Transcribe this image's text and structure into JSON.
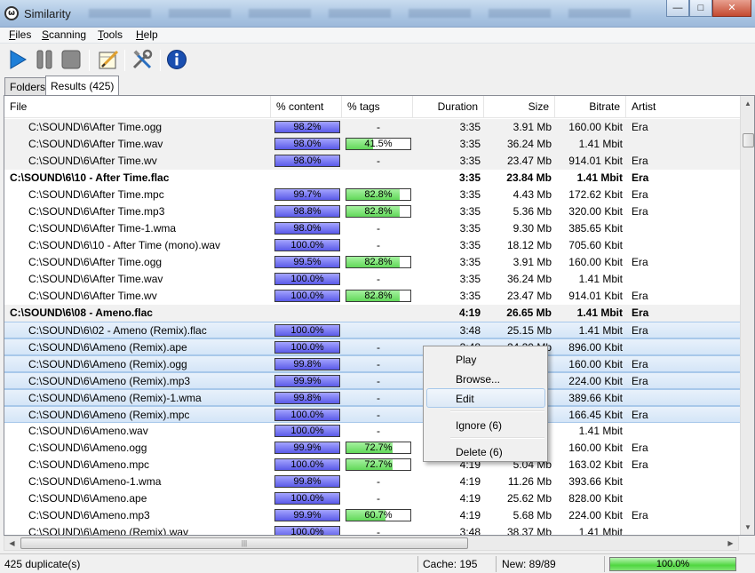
{
  "window": {
    "title": "Similarity"
  },
  "menu": {
    "files": "Files",
    "scanning": "Scanning",
    "tools": "Tools",
    "help": "Help"
  },
  "toolbar": {
    "icons": [
      "play-icon",
      "pause-icon",
      "stop-icon",
      "edit-icon",
      "tools-icon",
      "info-icon"
    ],
    "colors": {
      "play": "#1e7fd8",
      "info": "#1a4fb0"
    }
  },
  "tabs": {
    "folders": "Folders",
    "results": "Results (425)"
  },
  "columns": {
    "file": "File",
    "content": "% content",
    "tags": "% tags",
    "duration": "Duration",
    "size": "Size",
    "bitrate": "Bitrate",
    "artist": "Artist"
  },
  "rows": [
    {
      "kind": "child",
      "style": "shade",
      "file": "C:\\SOUND\\6\\After Time.ogg",
      "content": "98.2%",
      "tags": "-",
      "tags_pct": null,
      "duration": "3:35",
      "size": "3.91 Mb",
      "bitrate": "160.00 Kbit",
      "artist": "Era"
    },
    {
      "kind": "child",
      "style": "shade",
      "file": "C:\\SOUND\\6\\After Time.wav",
      "content": "98.0%",
      "tags": "41.5%",
      "tags_pct": 41.5,
      "duration": "3:35",
      "size": "36.24 Mb",
      "bitrate": "1.41 Mbit",
      "artist": ""
    },
    {
      "kind": "child",
      "style": "shade",
      "file": "C:\\SOUND\\6\\After Time.wv",
      "content": "98.0%",
      "tags": "-",
      "tags_pct": null,
      "duration": "3:35",
      "size": "23.47 Mb",
      "bitrate": "914.01 Kbit",
      "artist": "Era"
    },
    {
      "kind": "group",
      "style": "",
      "file": "C:\\SOUND\\6\\10 - After Time.flac",
      "content": "",
      "tags": "",
      "tags_pct": null,
      "duration": "3:35",
      "size": "23.84 Mb",
      "bitrate": "1.41 Mbit",
      "artist": "Era"
    },
    {
      "kind": "child",
      "style": "",
      "file": "C:\\SOUND\\6\\After Time.mpc",
      "content": "99.7%",
      "tags": "82.8%",
      "tags_pct": 82.8,
      "duration": "3:35",
      "size": "4.43 Mb",
      "bitrate": "172.62 Kbit",
      "artist": "Era"
    },
    {
      "kind": "child",
      "style": "",
      "file": "C:\\SOUND\\6\\After Time.mp3",
      "content": "98.8%",
      "tags": "82.8%",
      "tags_pct": 82.8,
      "duration": "3:35",
      "size": "5.36 Mb",
      "bitrate": "320.00 Kbit",
      "artist": "Era"
    },
    {
      "kind": "child",
      "style": "",
      "file": "C:\\SOUND\\6\\After Time-1.wma",
      "content": "98.0%",
      "tags": "-",
      "tags_pct": null,
      "duration": "3:35",
      "size": "9.30 Mb",
      "bitrate": "385.65 Kbit",
      "artist": ""
    },
    {
      "kind": "child",
      "style": "",
      "file": "C:\\SOUND\\6\\10 - After Time (mono).wav",
      "content": "100.0%",
      "tags": "-",
      "tags_pct": null,
      "duration": "3:35",
      "size": "18.12 Mb",
      "bitrate": "705.60 Kbit",
      "artist": ""
    },
    {
      "kind": "child",
      "style": "",
      "file": "C:\\SOUND\\6\\After Time.ogg",
      "content": "99.5%",
      "tags": "82.8%",
      "tags_pct": 82.8,
      "duration": "3:35",
      "size": "3.91 Mb",
      "bitrate": "160.00 Kbit",
      "artist": "Era"
    },
    {
      "kind": "child",
      "style": "",
      "file": "C:\\SOUND\\6\\After Time.wav",
      "content": "100.0%",
      "tags": "-",
      "tags_pct": null,
      "duration": "3:35",
      "size": "36.24 Mb",
      "bitrate": "1.41 Mbit",
      "artist": ""
    },
    {
      "kind": "child",
      "style": "",
      "file": "C:\\SOUND\\6\\After Time.wv",
      "content": "100.0%",
      "tags": "82.8%",
      "tags_pct": 82.8,
      "duration": "3:35",
      "size": "23.47 Mb",
      "bitrate": "914.01 Kbit",
      "artist": "Era"
    },
    {
      "kind": "group",
      "style": "shade",
      "file": "C:\\SOUND\\6\\08 - Ameno.flac",
      "content": "",
      "tags": "",
      "tags_pct": null,
      "duration": "4:19",
      "size": "26.65 Mb",
      "bitrate": "1.41 Mbit",
      "artist": "Era"
    },
    {
      "kind": "child",
      "style": "sel",
      "file": "C:\\SOUND\\6\\02 - Ameno (Remix).flac",
      "content": "100.0%",
      "tags": "",
      "tags_pct": null,
      "duration": "3:48",
      "size": "25.15 Mb",
      "bitrate": "1.41 Mbit",
      "artist": "Era"
    },
    {
      "kind": "child",
      "style": "sel",
      "file": "C:\\SOUND\\6\\Ameno (Remix).ape",
      "content": "100.0%",
      "tags": "-",
      "tags_pct": null,
      "duration": "3:48",
      "size": "24.20 Mb",
      "bitrate": "896.00 Kbit",
      "artist": ""
    },
    {
      "kind": "child",
      "style": "sel",
      "file": "C:\\SOUND\\6\\Ameno (Remix).ogg",
      "content": "99.8%",
      "tags": "-",
      "tags_pct": null,
      "duration": "",
      "size": "",
      "bitrate": "160.00 Kbit",
      "artist": "Era"
    },
    {
      "kind": "child",
      "style": "sel",
      "file": "C:\\SOUND\\6\\Ameno (Remix).mp3",
      "content": "99.9%",
      "tags": "-",
      "tags_pct": null,
      "duration": "",
      "size": "",
      "bitrate": "224.00 Kbit",
      "artist": "Era"
    },
    {
      "kind": "child",
      "style": "sel",
      "file": "C:\\SOUND\\6\\Ameno (Remix)-1.wma",
      "content": "99.8%",
      "tags": "-",
      "tags_pct": null,
      "duration": "",
      "size": "",
      "bitrate": "389.66 Kbit",
      "artist": ""
    },
    {
      "kind": "child",
      "style": "sel",
      "file": "C:\\SOUND\\6\\Ameno (Remix).mpc",
      "content": "100.0%",
      "tags": "-",
      "tags_pct": null,
      "duration": "",
      "size": "",
      "bitrate": "166.45 Kbit",
      "artist": "Era"
    },
    {
      "kind": "child",
      "style": "",
      "file": "C:\\SOUND\\6\\Ameno.wav",
      "content": "100.0%",
      "tags": "-",
      "tags_pct": null,
      "duration": "",
      "size": "",
      "bitrate": "1.41 Mbit",
      "artist": ""
    },
    {
      "kind": "child",
      "style": "",
      "file": "C:\\SOUND\\6\\Ameno.ogg",
      "content": "99.9%",
      "tags": "72.7%",
      "tags_pct": 72.7,
      "duration": "",
      "size": "",
      "bitrate": "160.00 Kbit",
      "artist": "Era"
    },
    {
      "kind": "child",
      "style": "",
      "file": "C:\\SOUND\\6\\Ameno.mpc",
      "content": "100.0%",
      "tags": "72.7%",
      "tags_pct": 72.7,
      "duration": "4:19",
      "size": "5.04 Mb",
      "bitrate": "163.02 Kbit",
      "artist": "Era"
    },
    {
      "kind": "child",
      "style": "",
      "file": "C:\\SOUND\\6\\Ameno-1.wma",
      "content": "99.8%",
      "tags": "-",
      "tags_pct": null,
      "duration": "4:19",
      "size": "11.26 Mb",
      "bitrate": "393.66 Kbit",
      "artist": ""
    },
    {
      "kind": "child",
      "style": "",
      "file": "C:\\SOUND\\6\\Ameno.ape",
      "content": "100.0%",
      "tags": "-",
      "tags_pct": null,
      "duration": "4:19",
      "size": "25.62 Mb",
      "bitrate": "828.00 Kbit",
      "artist": ""
    },
    {
      "kind": "child",
      "style": "",
      "file": "C:\\SOUND\\6\\Ameno.mp3",
      "content": "99.9%",
      "tags": "60.7%",
      "tags_pct": 60.7,
      "duration": "4:19",
      "size": "5.68 Mb",
      "bitrate": "224.00 Kbit",
      "artist": "Era"
    },
    {
      "kind": "child",
      "style": "",
      "file": "C:\\SOUND\\6\\Ameno (Remix).wav",
      "content": "100.0%",
      "tags": "-",
      "tags_pct": null,
      "duration": "3:48",
      "size": "38.37 Mb",
      "bitrate": "1.41 Mbit",
      "artist": ""
    }
  ],
  "context_menu": {
    "play": "Play",
    "browse": "Browse...",
    "edit": "Edit",
    "ignore": "Ignore (6)",
    "delete": "Delete (6)"
  },
  "status": {
    "duplicates": "425 duplicate(s)",
    "cache": "Cache: 195",
    "new": "New: 89/89",
    "progress_label": "100.0%",
    "progress_pct": 100
  },
  "colors": {
    "content_bar": "#6b6bf0",
    "tags_bar": "#62d85a",
    "selection": "#d4e5f7",
    "progress": "#4fd640"
  }
}
